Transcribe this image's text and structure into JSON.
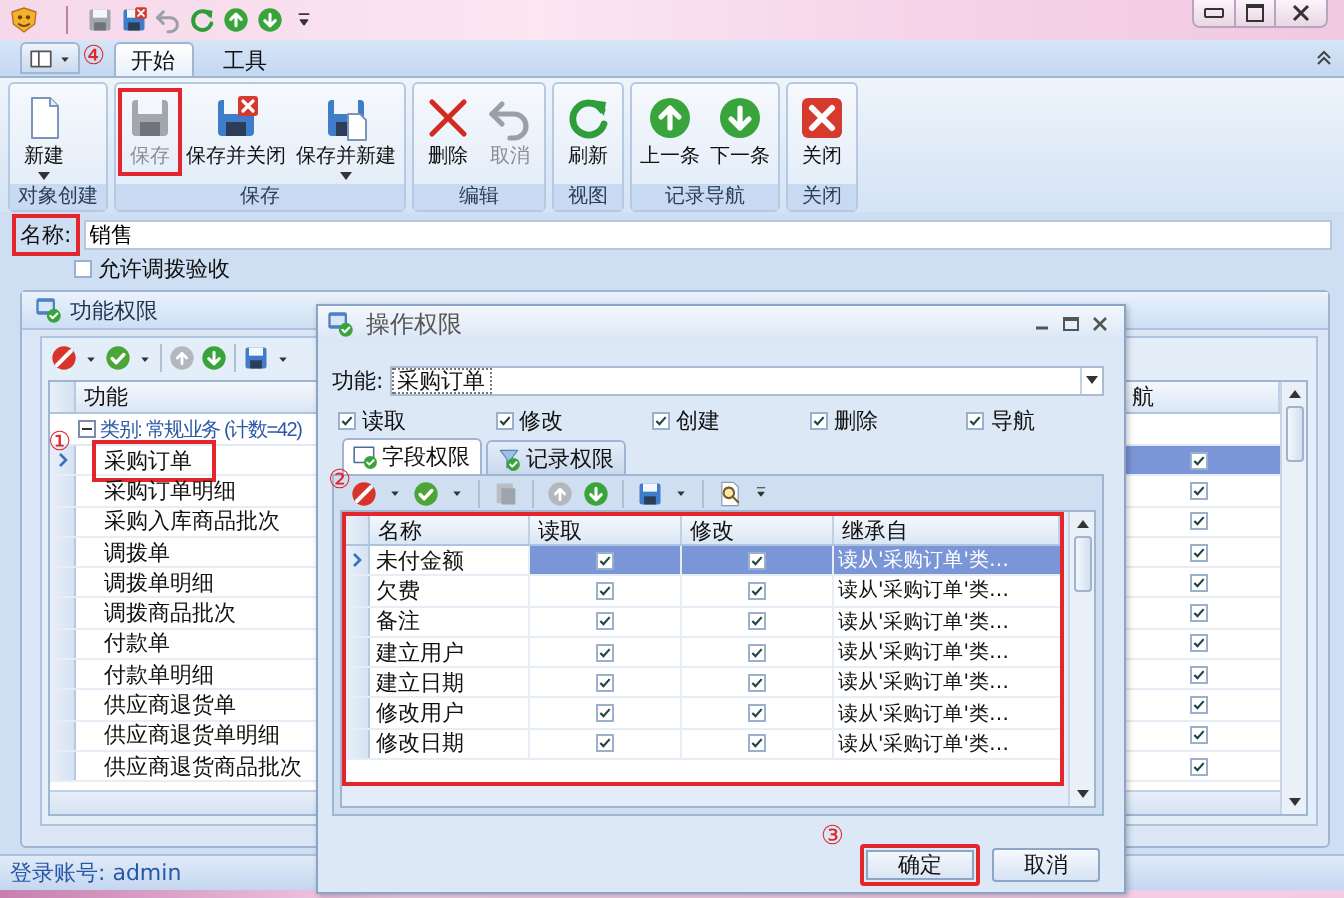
{
  "ribbon": {
    "app_menu": {
      "marker": "④"
    },
    "tabs": [
      {
        "label": "开始",
        "selected": true
      },
      {
        "label": "工具",
        "selected": false
      }
    ],
    "groups": [
      {
        "label": "对象创建",
        "buttons": [
          {
            "label": "新建",
            "disabled": false,
            "dropdown": true,
            "highlighted": false
          }
        ]
      },
      {
        "label": "保存",
        "buttons": [
          {
            "label": "保存",
            "disabled": true,
            "dropdown": false,
            "highlighted": true
          },
          {
            "label": "保存并关闭",
            "disabled": false,
            "dropdown": false,
            "highlighted": false
          },
          {
            "label": "保存并新建",
            "disabled": false,
            "dropdown": true,
            "highlighted": false
          }
        ]
      },
      {
        "label": "编辑",
        "buttons": [
          {
            "label": "删除",
            "disabled": false,
            "dropdown": false,
            "highlighted": false
          },
          {
            "label": "取消",
            "disabled": true,
            "dropdown": false,
            "highlighted": false
          }
        ]
      },
      {
        "label": "视图",
        "buttons": [
          {
            "label": "刷新",
            "disabled": false,
            "dropdown": false,
            "highlighted": false
          }
        ]
      },
      {
        "label": "记录导航",
        "buttons": [
          {
            "label": "上一条",
            "disabled": false,
            "dropdown": false,
            "highlighted": false
          },
          {
            "label": "下一条",
            "disabled": false,
            "dropdown": false,
            "highlighted": false
          }
        ]
      },
      {
        "label": "关闭",
        "buttons": [
          {
            "label": "关闭",
            "disabled": false,
            "dropdown": false,
            "highlighted": false
          }
        ]
      }
    ]
  },
  "name_field": {
    "label": "名称:",
    "value": "销售",
    "highlighted": true
  },
  "allow_check": {
    "label": "允许调拨验收",
    "checked": false
  },
  "function_panel": {
    "title": "功能权限",
    "grid": {
      "columns": [
        "功能",
        "航"
      ],
      "group": {
        "label": "类别: 常规业务 (计数=42)",
        "expanded": true
      },
      "rows": [
        {
          "name": "采购订单",
          "nav": true,
          "selected": true,
          "highlighted": true,
          "marker": "①"
        },
        {
          "name": "采购订单明细",
          "nav": true,
          "selected": false,
          "highlighted": false
        },
        {
          "name": "采购入库商品批次",
          "nav": true,
          "selected": false,
          "highlighted": false
        },
        {
          "name": "调拨单",
          "nav": true,
          "selected": false,
          "highlighted": false
        },
        {
          "name": "调拨单明细",
          "nav": true,
          "selected": false,
          "highlighted": false
        },
        {
          "name": "调拨商品批次",
          "nav": true,
          "selected": false,
          "highlighted": false
        },
        {
          "name": "付款单",
          "nav": true,
          "selected": false,
          "highlighted": false
        },
        {
          "name": "付款单明细",
          "nav": true,
          "selected": false,
          "highlighted": false
        },
        {
          "name": "供应商退货单",
          "nav": true,
          "selected": false,
          "highlighted": false
        },
        {
          "name": "供应商退货单明细",
          "nav": true,
          "selected": false,
          "highlighted": false
        },
        {
          "name": "供应商退货商品批次",
          "nav": true,
          "selected": false,
          "highlighted": false
        }
      ]
    }
  },
  "status_bar": "登录账号: admin",
  "dialog": {
    "title": "操作权限",
    "function": {
      "label": "功能:",
      "value": "采购订单"
    },
    "permissions": [
      {
        "label": "读取",
        "checked": true
      },
      {
        "label": "修改",
        "checked": true
      },
      {
        "label": "创建",
        "checked": true
      },
      {
        "label": "删除",
        "checked": true
      },
      {
        "label": "导航",
        "checked": true
      }
    ],
    "tabs": [
      {
        "label": "字段权限",
        "selected": true
      },
      {
        "label": "记录权限",
        "selected": false
      }
    ],
    "grid": {
      "highlighted": true,
      "marker": "②",
      "columns": [
        "名称",
        "读取",
        "修改",
        "继承自"
      ],
      "rows": [
        {
          "name": "未付金额",
          "read": true,
          "modify": true,
          "inherit": "读从'采购订单'类…",
          "selected": true
        },
        {
          "name": "欠费",
          "read": true,
          "modify": true,
          "inherit": "读从'采购订单'类…",
          "selected": false
        },
        {
          "name": "备注",
          "read": true,
          "modify": true,
          "inherit": "读从'采购订单'类…",
          "selected": false
        },
        {
          "name": "建立用户",
          "read": true,
          "modify": true,
          "inherit": "读从'采购订单'类…",
          "selected": false
        },
        {
          "name": "建立日期",
          "read": true,
          "modify": true,
          "inherit": "读从'采购订单'类…",
          "selected": false
        },
        {
          "name": "修改用户",
          "read": true,
          "modify": true,
          "inherit": "读从'采购订单'类…",
          "selected": false
        },
        {
          "name": "修改日期",
          "read": true,
          "modify": true,
          "inherit": "读从'采购订单'类…",
          "selected": false
        }
      ]
    },
    "buttons": [
      {
        "label": "确定",
        "highlighted": true,
        "marker": "③"
      },
      {
        "label": "取消",
        "highlighted": false
      }
    ]
  }
}
